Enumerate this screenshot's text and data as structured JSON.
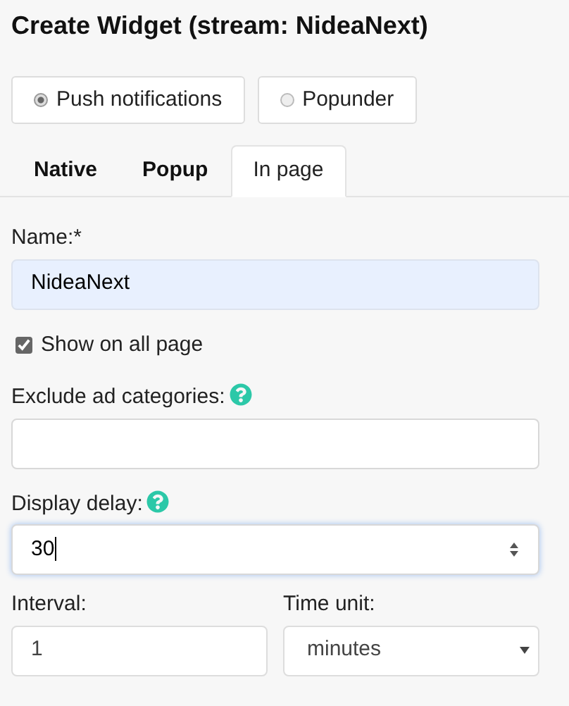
{
  "title": "Create Widget (stream: NideaNext)",
  "types": [
    {
      "label": "Push notifications",
      "selected": true
    },
    {
      "label": "Popunder",
      "selected": false
    }
  ],
  "tabs": [
    {
      "label": "Native",
      "selected": false
    },
    {
      "label": "Popup",
      "selected": false
    },
    {
      "label": "In page",
      "selected": true
    }
  ],
  "fields": [
    {
      "kind": "text",
      "label": "Name:*",
      "value": "NideaNext",
      "autofilled": true,
      "help": false
    },
    {
      "kind": "checkbox",
      "label": "Show on all page",
      "checked": true
    },
    {
      "kind": "text",
      "label": "Exclude ad categories:",
      "autofilled": false,
      "help": true
    },
    {
      "kind": "number",
      "label": "Display delay:",
      "value": "30",
      "focused": true,
      "help": true
    }
  ],
  "interval": {
    "label": "Interval:",
    "value": "1"
  },
  "time_unit": {
    "label": "Time unit:",
    "value": "minutes"
  }
}
